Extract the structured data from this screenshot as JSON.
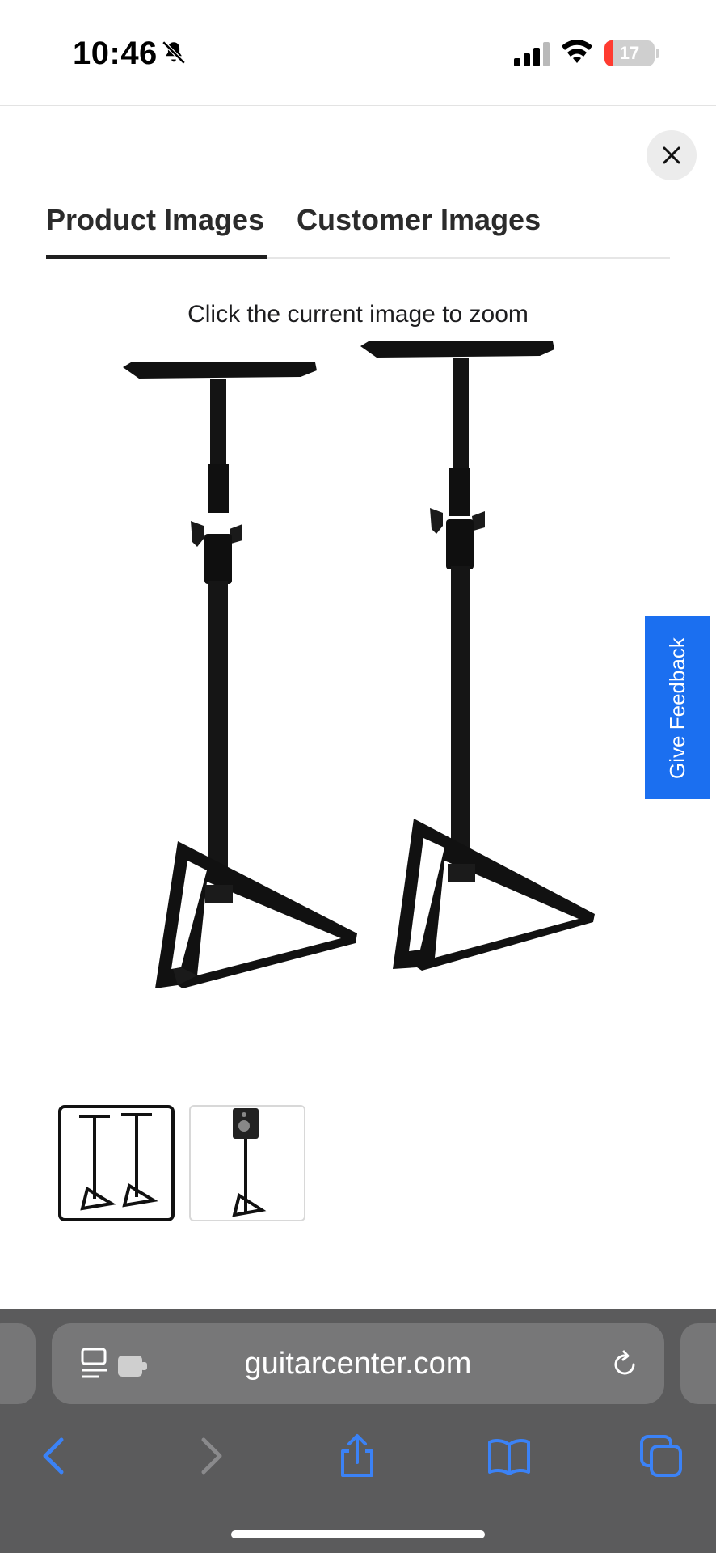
{
  "status_bar": {
    "time": "10:46",
    "battery_level": "17",
    "battery_fraction": 0.17,
    "icons": [
      "bell-slash-icon",
      "cellular-signal-icon",
      "wifi-icon",
      "battery-icon"
    ]
  },
  "modal": {
    "close_icon": "close-icon",
    "tabs": [
      {
        "label": "Product Images",
        "active": true
      },
      {
        "label": "Customer Images",
        "active": false
      }
    ],
    "zoom_hint": "Click the current image to zoom",
    "main_image": "pair of black speaker stands with triangular bases",
    "thumbnails": [
      {
        "depicts": "two speaker stands",
        "selected": true
      },
      {
        "depicts": "speaker stand with monitor",
        "selected": false
      }
    ]
  },
  "feedback": {
    "label": "Give Feedback"
  },
  "browser": {
    "url": "guitarcenter.com",
    "address_icons": [
      "page-menu-icon",
      "reload-icon"
    ],
    "toolbar_icons": [
      "back-icon",
      "forward-icon",
      "share-icon",
      "bookmarks-icon",
      "tabs-icon"
    ]
  },
  "colors": {
    "accent_feedback": "#1b6ff0",
    "browser_chrome": "#5b5b5c",
    "toolbar_icon": "#3b82f6",
    "battery_low": "#ff3b30"
  }
}
